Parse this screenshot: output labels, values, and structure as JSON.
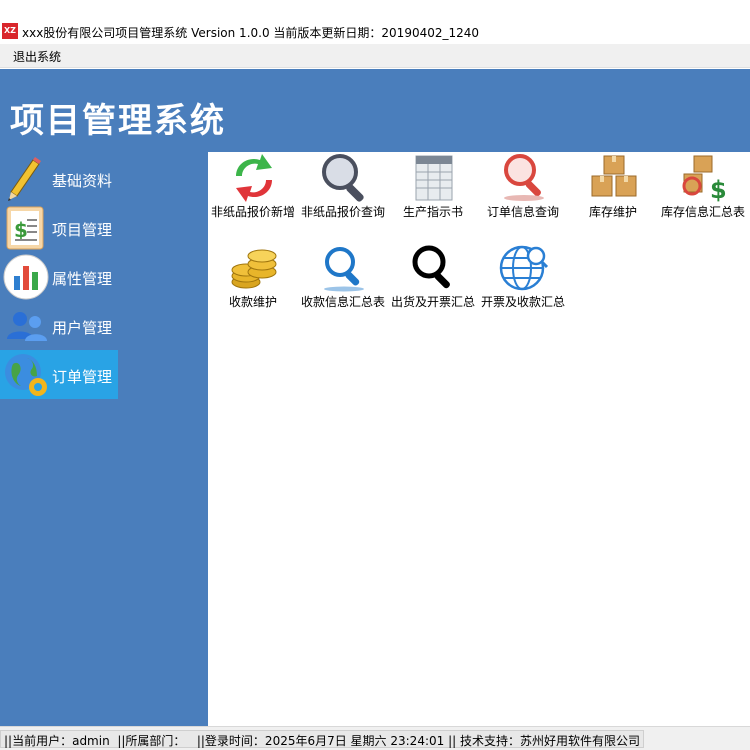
{
  "window": {
    "logo_text": "XZ",
    "title": "xxx股份有限公司项目管理系统 Version 1.0.0 当前版本更新日期：20190402_1240"
  },
  "menubar": {
    "items": [
      {
        "label": "退出系统"
      }
    ]
  },
  "header": {
    "app_title": "项目管理系统"
  },
  "sidebar": {
    "items": [
      {
        "label": "基础资料",
        "icon": "pencil-icon",
        "active": false
      },
      {
        "label": "项目管理",
        "icon": "document-icon",
        "active": false
      },
      {
        "label": "属性管理",
        "icon": "bar-chart-icon",
        "active": false
      },
      {
        "label": "用户管理",
        "icon": "users-icon",
        "active": false
      },
      {
        "label": "订单管理",
        "icon": "globe-gear-icon",
        "active": true
      }
    ]
  },
  "content": {
    "tiles": [
      {
        "label": "非纸品报价新增",
        "icon": "refresh-arrows-icon"
      },
      {
        "label": "非纸品报价查询",
        "icon": "magnifier-icon"
      },
      {
        "label": "生产指示书",
        "icon": "spreadsheet-icon"
      },
      {
        "label": "订单信息查询",
        "icon": "red-magnifier-icon"
      },
      {
        "label": "库存维护",
        "icon": "boxes-icon"
      },
      {
        "label": "库存信息汇总表",
        "icon": "boxes-dollar-icon"
      },
      {
        "label": "收款维护",
        "icon": "coins-icon"
      },
      {
        "label": "收款信息汇总表",
        "icon": "blue-search-icon"
      },
      {
        "label": "出货及开票汇总",
        "icon": "black-search-icon"
      },
      {
        "label": "开票及收款汇总",
        "icon": "globe-search-icon"
      }
    ]
  },
  "statusbar": {
    "text": "||当前用户：admin  ||所属部门：   ||登录时间：2025年6月7日 星期六 23:24:01 || 技术支持：苏州好用软件有限公司"
  },
  "colors": {
    "header_bg": "#4a7ebc",
    "active_item_bg": "#29a3e5"
  }
}
